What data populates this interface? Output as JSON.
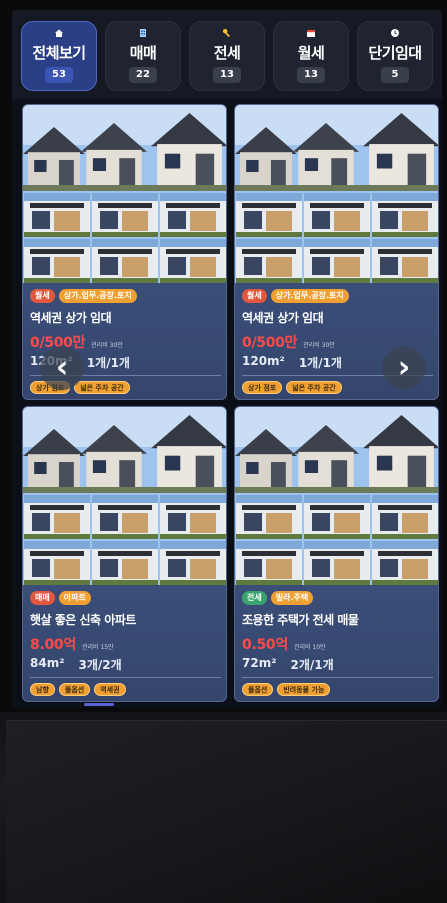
{
  "tabs": [
    {
      "icon": "home-icon",
      "label": "전체보기",
      "count": "53",
      "active": true
    },
    {
      "icon": "building-icon",
      "label": "매매",
      "count": "22",
      "active": false
    },
    {
      "icon": "key-icon",
      "label": "전세",
      "count": "13",
      "active": false
    },
    {
      "icon": "calendar-icon",
      "label": "월세",
      "count": "13",
      "active": false
    },
    {
      "icon": "clock-icon",
      "label": "단기임대",
      "count": "5",
      "active": false
    }
  ],
  "cards": [
    {
      "type_badge": "월세",
      "category_badge": "상가.업무.공장.토지",
      "title": "역세권 상가 임대",
      "price": "0/500만",
      "price_note": "관리비 30만",
      "area": "120m²",
      "rooms": "1개/1개",
      "features": [
        "상가 점포",
        "넓은 주차 공간"
      ]
    },
    {
      "type_badge": "월세",
      "category_badge": "상가.업무.공장.토지",
      "title": "역세권 상가 임대",
      "price": "0/500만",
      "price_note": "관리비 30만",
      "area": "120m²",
      "rooms": "1개/1개",
      "features": [
        "상가 점포",
        "넓은 주차 공간"
      ]
    },
    {
      "type_badge": "매매",
      "category_badge": "아파트",
      "title": "햇살 좋은 신축 아파트",
      "price": "8.00억",
      "price_note": "관리비 15만",
      "area": "84m²",
      "rooms": "3개/2개",
      "features": [
        "남향",
        "풀옵션",
        "역세권"
      ]
    },
    {
      "type_badge": "전세",
      "category_badge": "빌라.주택",
      "title": "조용한 주택가 전세 매물",
      "price": "0.50억",
      "price_note": "관리비 10만",
      "area": "72m²",
      "rooms": "2개/1개",
      "features": [
        "풀옵션",
        "반려동물 가능"
      ]
    }
  ],
  "nav": {
    "prev_icon": "chevron-left-icon",
    "next_icon": "chevron-right-icon",
    "prev_glyph": "‹",
    "next_glyph": "›"
  },
  "colors": {
    "accent": "#2b3f86",
    "price": "#ff4a4a",
    "feature_tag": "#f0a032",
    "card_bg": "#3b4e78"
  }
}
